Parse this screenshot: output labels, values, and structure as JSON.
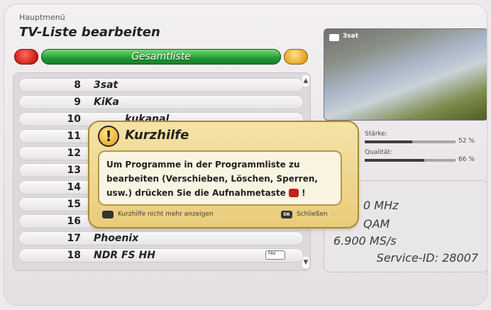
{
  "header": {
    "breadcrumb": "Hauptmenü",
    "title": "TV-Liste bearbeiten"
  },
  "list_selector": {
    "label": "Gesamtliste"
  },
  "channels": [
    {
      "num": "8",
      "name": "3sat"
    },
    {
      "num": "9",
      "name": "KiKa"
    },
    {
      "num": "10",
      "name": "kukanal"
    },
    {
      "num": "11",
      "name": ""
    },
    {
      "num": "12",
      "name": ""
    },
    {
      "num": "13",
      "name": ""
    },
    {
      "num": "14",
      "name": ""
    },
    {
      "num": "15",
      "name": ""
    },
    {
      "num": "16",
      "name": ""
    },
    {
      "num": "17",
      "name": "Phoenix"
    },
    {
      "num": "18",
      "name": "NDR FS HH",
      "badge": "FAV"
    }
  ],
  "preview": {
    "channel": "3sat"
  },
  "signal": {
    "strength_label": "Stärke:",
    "strength_value": "52 %",
    "strength_level": 0.52,
    "quality_label": "Qualität:",
    "quality_value": "66 %",
    "quality_level": 0.66
  },
  "info": {
    "frequency": "0 MHz",
    "modulation": "QAM",
    "symbolrate": "6.900 MS/s",
    "service": "Service-ID: 28007"
  },
  "dialog": {
    "title": "Kurzhilfe",
    "message": "Um Programme in der Programmliste zu bearbeiten (Verschieben, Löschen, Sperren, usw.) drücken Sie die Aufnahmetaste",
    "message_end": "!",
    "left_key": "",
    "left_hint": "Kurzhilfe nicht mehr anzeigen",
    "right_key": "OK",
    "right_hint": "Schließen"
  },
  "colors": {
    "red_key": "#d3261c",
    "green_key": "#2aa13d",
    "yellow_key": "#eab11e",
    "dialog_bg": "#efd792"
  }
}
